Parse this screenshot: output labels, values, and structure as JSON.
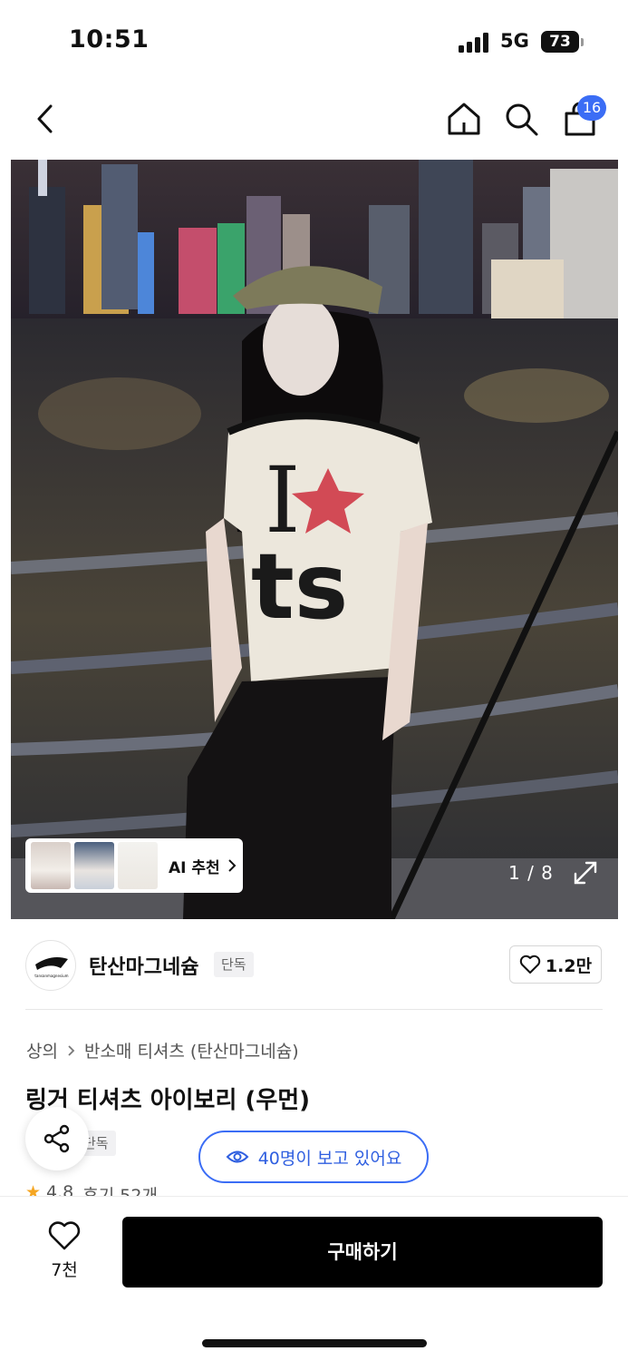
{
  "status": {
    "time": "10:51",
    "network": "5G",
    "battery": "73"
  },
  "nav": {
    "back_icon": "chevron-left-icon",
    "home_icon": "home-icon",
    "search_icon": "search-icon",
    "cart_icon": "cart-icon",
    "cart_badge": "16"
  },
  "hero": {
    "ai_recommend_label": "AI 추천",
    "image_counter": "1 / 8",
    "shirt_print_top": "I",
    "shirt_print_bottom": "ts"
  },
  "store": {
    "name": "탄산마그네슘",
    "tag": "단독",
    "likes": "1.2만",
    "logo_text": "tansanmagnesium"
  },
  "breadcrumb": {
    "category": "상의",
    "subcategory": "반소매 티셔츠 (탄산마그네슘)"
  },
  "product": {
    "title": "링거 티셔츠 아이보리 (우먼)",
    "tag": "단독",
    "viewers": "40명이 보고 있어요",
    "rating": "4.8",
    "reviews": "후기 52개"
  },
  "bottom_bar": {
    "wish_count": "7천",
    "buy_label": "구매하기"
  },
  "colors": {
    "accent": "#3b6df5",
    "buy_button": "#000000"
  }
}
